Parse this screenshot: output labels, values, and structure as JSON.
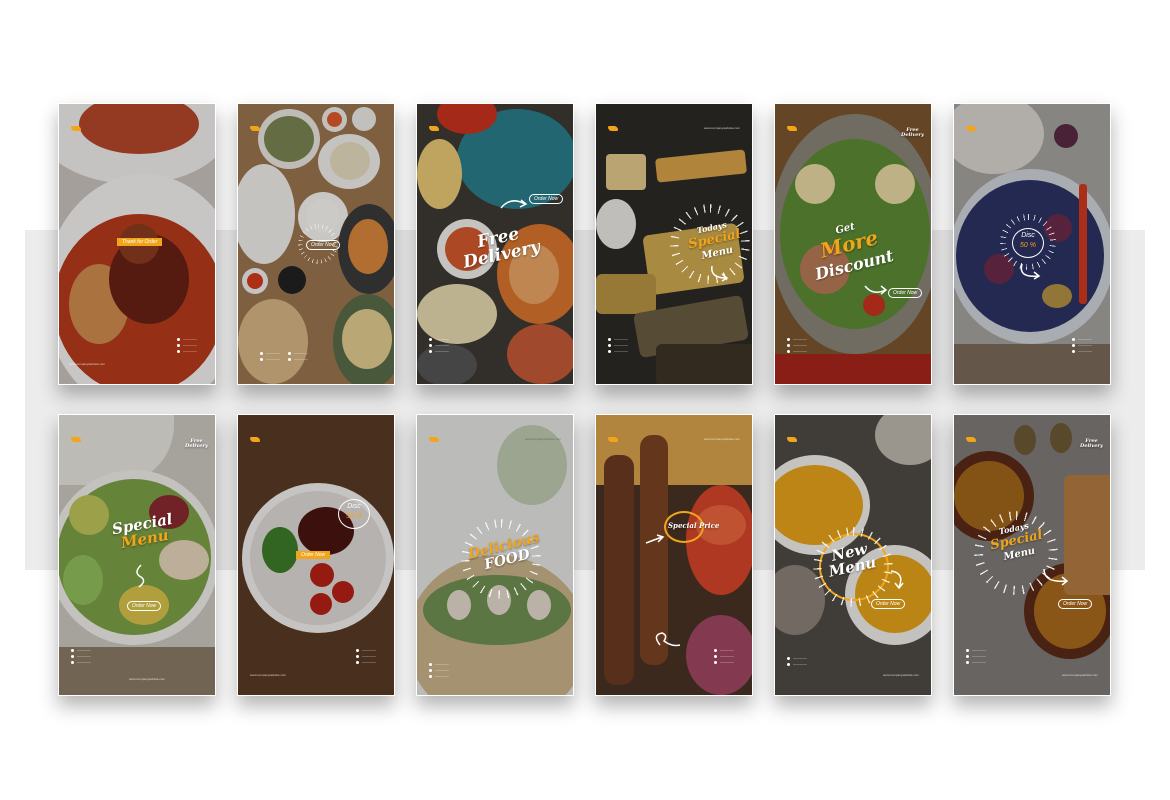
{
  "colors": {
    "accent": "#f3a51a",
    "band": "#ececec"
  },
  "cards": [
    {
      "name": "card-thank-order",
      "lines": [
        "Thank for",
        "Order"
      ]
    },
    {
      "name": "card-order-now",
      "button": "Order Now"
    },
    {
      "name": "card-free-delivery",
      "lines": [
        "Free",
        "Delivery"
      ],
      "button": "Order Now"
    },
    {
      "name": "card-todays-special",
      "lines": [
        "Todays",
        "Special",
        "Menu"
      ]
    },
    {
      "name": "card-more-discount",
      "lines": [
        "Get",
        "More",
        "Discount"
      ],
      "button": "Order Now",
      "corner": [
        "Free",
        "Delivery"
      ]
    },
    {
      "name": "card-disc-50",
      "lines": [
        "Disc",
        "50 %"
      ]
    },
    {
      "name": "card-special-menu",
      "lines": [
        "Special",
        "Menu"
      ],
      "button": "Order Now",
      "corner": [
        "Free",
        "Delivery"
      ]
    },
    {
      "name": "card-disc-steak",
      "lines": [
        "Disc",
        "50 %"
      ],
      "button": "Order Now"
    },
    {
      "name": "card-delicious-food",
      "lines": [
        "Delicious",
        "FOOD"
      ]
    },
    {
      "name": "card-special-price",
      "lines": [
        "Special Price"
      ]
    },
    {
      "name": "card-new-menu",
      "lines": [
        "New",
        "Menu"
      ],
      "button": "Order Now"
    },
    {
      "name": "card-todays-special-2",
      "lines": [
        "Todays",
        "Special",
        "Menu"
      ],
      "button": "Order Now",
      "corner": [
        "Free",
        "Delivery"
      ]
    }
  ]
}
